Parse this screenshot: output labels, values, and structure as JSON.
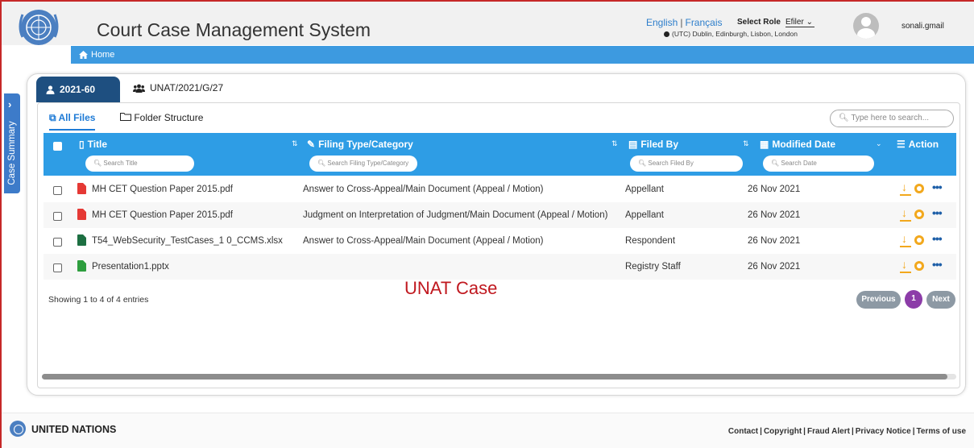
{
  "app": {
    "title": "Court Case Management System",
    "home_label": "Home"
  },
  "header": {
    "lang_en": "English",
    "lang_fr": "Français",
    "role_label": "Select Role",
    "role_value": "Efiler",
    "timezone": "(UTC) Dublin, Edinburgh, Lisbon, London",
    "username": "sonali.gmail"
  },
  "side_tab": {
    "label": "Case Summary"
  },
  "case_tabs": [
    {
      "label": "2021-60",
      "icon": "user-icon",
      "active": true
    },
    {
      "label": "UNAT/2021/G/27",
      "icon": "users-icon",
      "active": false
    }
  ],
  "sub_tabs": {
    "all_files": "All Files",
    "folder_structure": "Folder Structure"
  },
  "search": {
    "placeholder": "Type here to search..."
  },
  "table": {
    "columns": {
      "title": "Title",
      "filing_type": "Filing Type/Category",
      "filed_by": "Filed By",
      "modified_date": "Modified Date",
      "action": "Action"
    },
    "filters": {
      "title": "Search Title",
      "filing_type": "Search Filing Type/Category",
      "filed_by": "Search Filed By",
      "date": "Search Date"
    },
    "rows": [
      {
        "file_type": "pdf",
        "title": "MH CET Question Paper 2015.pdf",
        "filing_type": "Answer to Cross-Appeal/Main Document (Appeal / Motion)",
        "filed_by": "Appellant",
        "date": "26 Nov 2021"
      },
      {
        "file_type": "pdf",
        "title": "MH CET Question Paper 2015.pdf",
        "filing_type": "Judgment on Interpretation of Judgment/Main Document (Appeal / Motion)",
        "filed_by": "Appellant",
        "date": "26 Nov 2021"
      },
      {
        "file_type": "xlsx",
        "title": "T54_WebSecurity_TestCases_1 0_CCMS.xlsx",
        "filing_type": "Answer to Cross-Appeal/Main Document (Appeal / Motion)",
        "filed_by": "Respondent",
        "date": "26 Nov 2021"
      },
      {
        "file_type": "pptx",
        "title": "Presentation1.pptx",
        "filing_type": "",
        "filed_by": "Registry Staff",
        "date": "26 Nov 2021"
      }
    ]
  },
  "table_info": "Showing 1 to 4 of 4 entries",
  "watermark": "UNAT Case",
  "pagination": {
    "previous": "Previous",
    "current": "1",
    "next": "Next"
  },
  "footer": {
    "org": "UNITED NATIONS",
    "links": [
      "Contact",
      "Copyright",
      "Fraud Alert",
      "Privacy Notice",
      "Terms of use"
    ]
  },
  "colors": {
    "nav_blue": "#3d9ae0",
    "header_blue": "#2e9de5",
    "tab_navy": "#1e4f80",
    "action_orange": "#f2a81d",
    "page_purple": "#8c3ca8",
    "watermark_red": "#c0181f"
  }
}
